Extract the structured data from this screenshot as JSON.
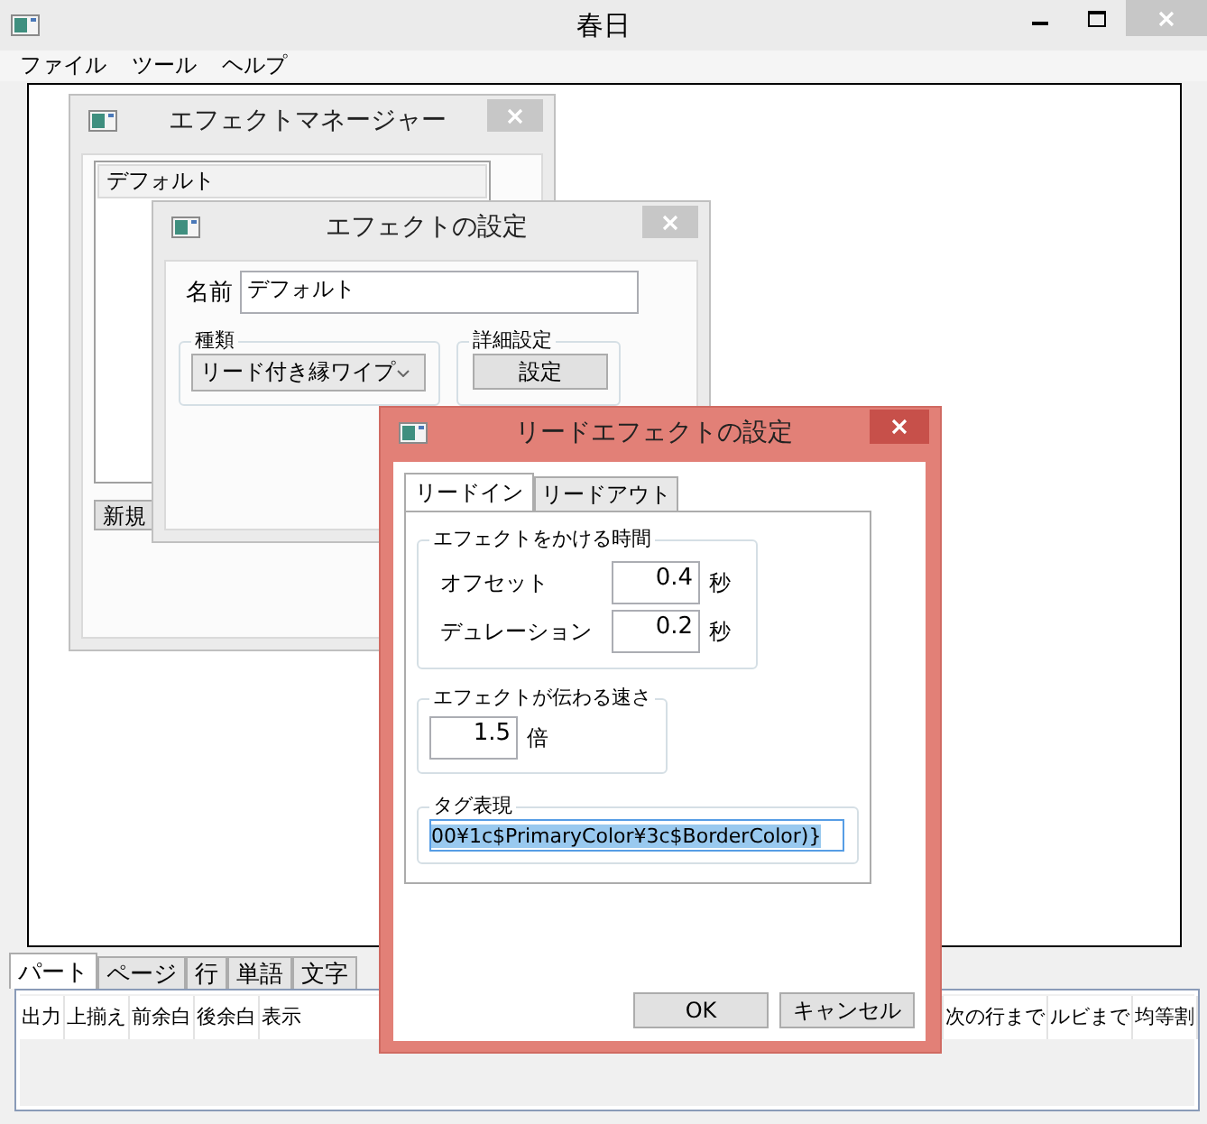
{
  "window": {
    "title": "春日"
  },
  "menu": [
    "ファイル",
    "ツール",
    "ヘルプ"
  ],
  "effect_manager": {
    "title": "エフェクトマネージャー",
    "active": false,
    "items": [
      {
        "label": "デフォルト",
        "selected": true
      }
    ],
    "buttons": [
      "新規"
    ]
  },
  "effect_settings": {
    "title": "エフェクトの設定",
    "active": false,
    "name_label": "名前",
    "name_value": "デフォルト",
    "type_group": "種類",
    "type_value": "リード付き縁ワイプ",
    "detail_group": "詳細設定",
    "detail_button": "設定"
  },
  "lead_effect_settings": {
    "title": "リードエフェクトの設定",
    "active": true,
    "tabs": [
      {
        "label": "リードイン",
        "selected": true
      },
      {
        "label": "リードアウト",
        "selected": false
      }
    ],
    "time_group": {
      "title": "エフェクトをかける時間",
      "rows": [
        {
          "label": "オフセット",
          "value": "0.4",
          "unit": "秒"
        },
        {
          "label": "デュレーション",
          "value": "0.2",
          "unit": "秒"
        }
      ]
    },
    "speed_group": {
      "title": "エフェクトが伝わる速さ",
      "value": "1.5",
      "unit": "倍"
    },
    "tag_group": {
      "title": "タグ表現",
      "value": "00¥1c$PrimaryColor¥3c$BorderColor)}",
      "selected": true
    },
    "buttons": [
      "OK",
      "キャンセル"
    ]
  },
  "bottom_tabs": [
    {
      "label": "パート",
      "selected": true
    },
    {
      "label": "ページ",
      "selected": false
    },
    {
      "label": "行",
      "selected": false
    },
    {
      "label": "単語",
      "selected": false
    },
    {
      "label": "文字",
      "selected": false
    }
  ],
  "table": {
    "columns": [
      {
        "label": "出力",
        "wide": false
      },
      {
        "label": "上揃え",
        "wide": false
      },
      {
        "label": "前余白",
        "wide": false
      },
      {
        "label": "後余白",
        "wide": false
      },
      {
        "label": "表示",
        "wide": true
      },
      {
        "label": "次の行まで",
        "wide": false
      },
      {
        "label": "ルビまで",
        "wide": false
      },
      {
        "label": "均等割",
        "wide": false
      }
    ]
  }
}
